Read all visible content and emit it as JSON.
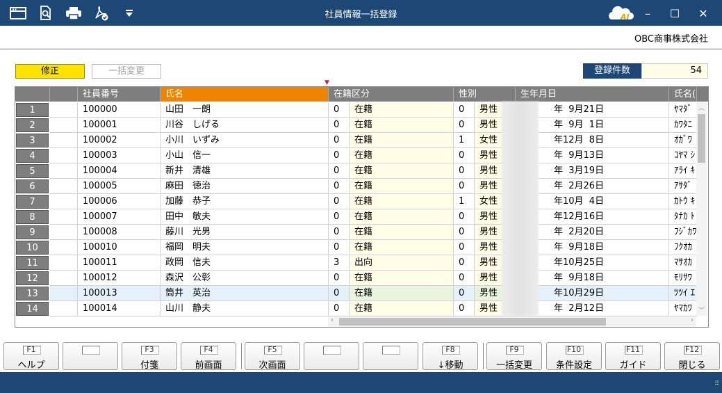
{
  "window": {
    "title": "社員情報一括登録"
  },
  "toolbar": {
    "icons": [
      "window-icon",
      "preview-icon",
      "print-icon",
      "pdf-icon",
      "dropdown-icon"
    ],
    "ai_label": "AI"
  },
  "company": {
    "name": "OBC商事株式会社"
  },
  "modes": {
    "edit": "修正",
    "batch_change": "一括変更"
  },
  "record_count": {
    "label": "登録件数",
    "value": "54"
  },
  "grid": {
    "columns": [
      "",
      "",
      "社員番号",
      "氏名",
      "在籍区分",
      "性別",
      "生年月日",
      "氏名("
    ],
    "rows": [
      {
        "no": "1",
        "id": "100000",
        "name": "山田　一朗",
        "status_code": "0",
        "status": "在籍",
        "gender_code": "0",
        "gender": "男性",
        "birth": "年  9月21日",
        "kana": "ﾔﾏﾀﾞ"
      },
      {
        "no": "2",
        "id": "100001",
        "name": "川谷　しげる",
        "status_code": "0",
        "status": "在籍",
        "gender_code": "0",
        "gender": "男性",
        "birth": "年  9月  1日",
        "kana": "ｶﾜﾀﾆ"
      },
      {
        "no": "3",
        "id": "100002",
        "name": "小川　いずみ",
        "status_code": "0",
        "status": "在籍",
        "gender_code": "1",
        "gender": "女性",
        "birth": "年12月  8日",
        "kana": "ｵｶﾞﾜ"
      },
      {
        "no": "4",
        "id": "100003",
        "name": "小山　信一",
        "status_code": "0",
        "status": "在籍",
        "gender_code": "0",
        "gender": "男性",
        "birth": "年  9月13日",
        "kana": "ｺﾔﾏ ｼ"
      },
      {
        "no": "5",
        "id": "100004",
        "name": "新井　清雄",
        "status_code": "0",
        "status": "在籍",
        "gender_code": "0",
        "gender": "男性",
        "birth": "年  3月19日",
        "kana": "ｱﾗｲ ｷ"
      },
      {
        "no": "6",
        "id": "100005",
        "name": "麻田　徳治",
        "status_code": "0",
        "status": "在籍",
        "gender_code": "0",
        "gender": "男性",
        "birth": "年  2月26日",
        "kana": "ｱｻﾀﾞ"
      },
      {
        "no": "7",
        "id": "100006",
        "name": "加藤　恭子",
        "status_code": "0",
        "status": "在籍",
        "gender_code": "1",
        "gender": "女性",
        "birth": "年10月  4日",
        "kana": "ｶﾄｳ ｷ"
      },
      {
        "no": "8",
        "id": "100007",
        "name": "田中　敏夫",
        "status_code": "0",
        "status": "在籍",
        "gender_code": "0",
        "gender": "男性",
        "birth": "年12月16日",
        "kana": "ﾀﾅｶ ﾄ"
      },
      {
        "no": "9",
        "id": "100008",
        "name": "藤川　光男",
        "status_code": "0",
        "status": "在籍",
        "gender_code": "0",
        "gender": "男性",
        "birth": "年  2月20日",
        "kana": "ﾌｼﾞｶﾜ"
      },
      {
        "no": "10",
        "id": "100010",
        "name": "福岡　明夫",
        "status_code": "0",
        "status": "在籍",
        "gender_code": "0",
        "gender": "男性",
        "birth": "年  9月18日",
        "kana": "ﾌｸｵｶ"
      },
      {
        "no": "11",
        "id": "100011",
        "name": "政岡　信夫",
        "status_code": "3",
        "status": "出向",
        "gender_code": "0",
        "gender": "男性",
        "birth": "年10月25日",
        "kana": "ﾏｻｵｶ"
      },
      {
        "no": "12",
        "id": "100012",
        "name": "森沢　公彰",
        "status_code": "0",
        "status": "在籍",
        "gender_code": "0",
        "gender": "男性",
        "birth": "年  9月18日",
        "kana": "ﾓﾘｻﾜ"
      },
      {
        "no": "13",
        "id": "100013",
        "name": "筒井　英治",
        "status_code": "0",
        "status": "在籍",
        "gender_code": "0",
        "gender": "男性",
        "birth": "年10月29日",
        "kana": "ﾂﾂｲ ｴ"
      },
      {
        "no": "14",
        "id": "100014",
        "name": "山川　静夫",
        "status_code": "0",
        "status": "在籍",
        "gender_code": "0",
        "gender": "男性",
        "birth": "年  2月12日",
        "kana": "ﾔﾏｶﾜ"
      }
    ],
    "selected_row": "13"
  },
  "fkeys": [
    {
      "key": "F1",
      "label": "ヘルプ"
    },
    {
      "key": "",
      "label": ""
    },
    {
      "key": "F3",
      "label": "付箋"
    },
    {
      "key": "F4",
      "label": "前画面"
    },
    {
      "key": "F5",
      "label": "次画面"
    },
    {
      "key": "",
      "label": ""
    },
    {
      "key": "",
      "label": ""
    },
    {
      "key": "F8",
      "label": "↓移動"
    },
    {
      "key": "F9",
      "label": "一括変更"
    },
    {
      "key": "F10",
      "label": "条件設定"
    },
    {
      "key": "F11",
      "label": "ガイド"
    },
    {
      "key": "F12",
      "label": "閉じる"
    }
  ],
  "colors": {
    "titlebar": "#1d4775",
    "active_header": "#ef8400",
    "edit_mode": "#ffe300"
  }
}
